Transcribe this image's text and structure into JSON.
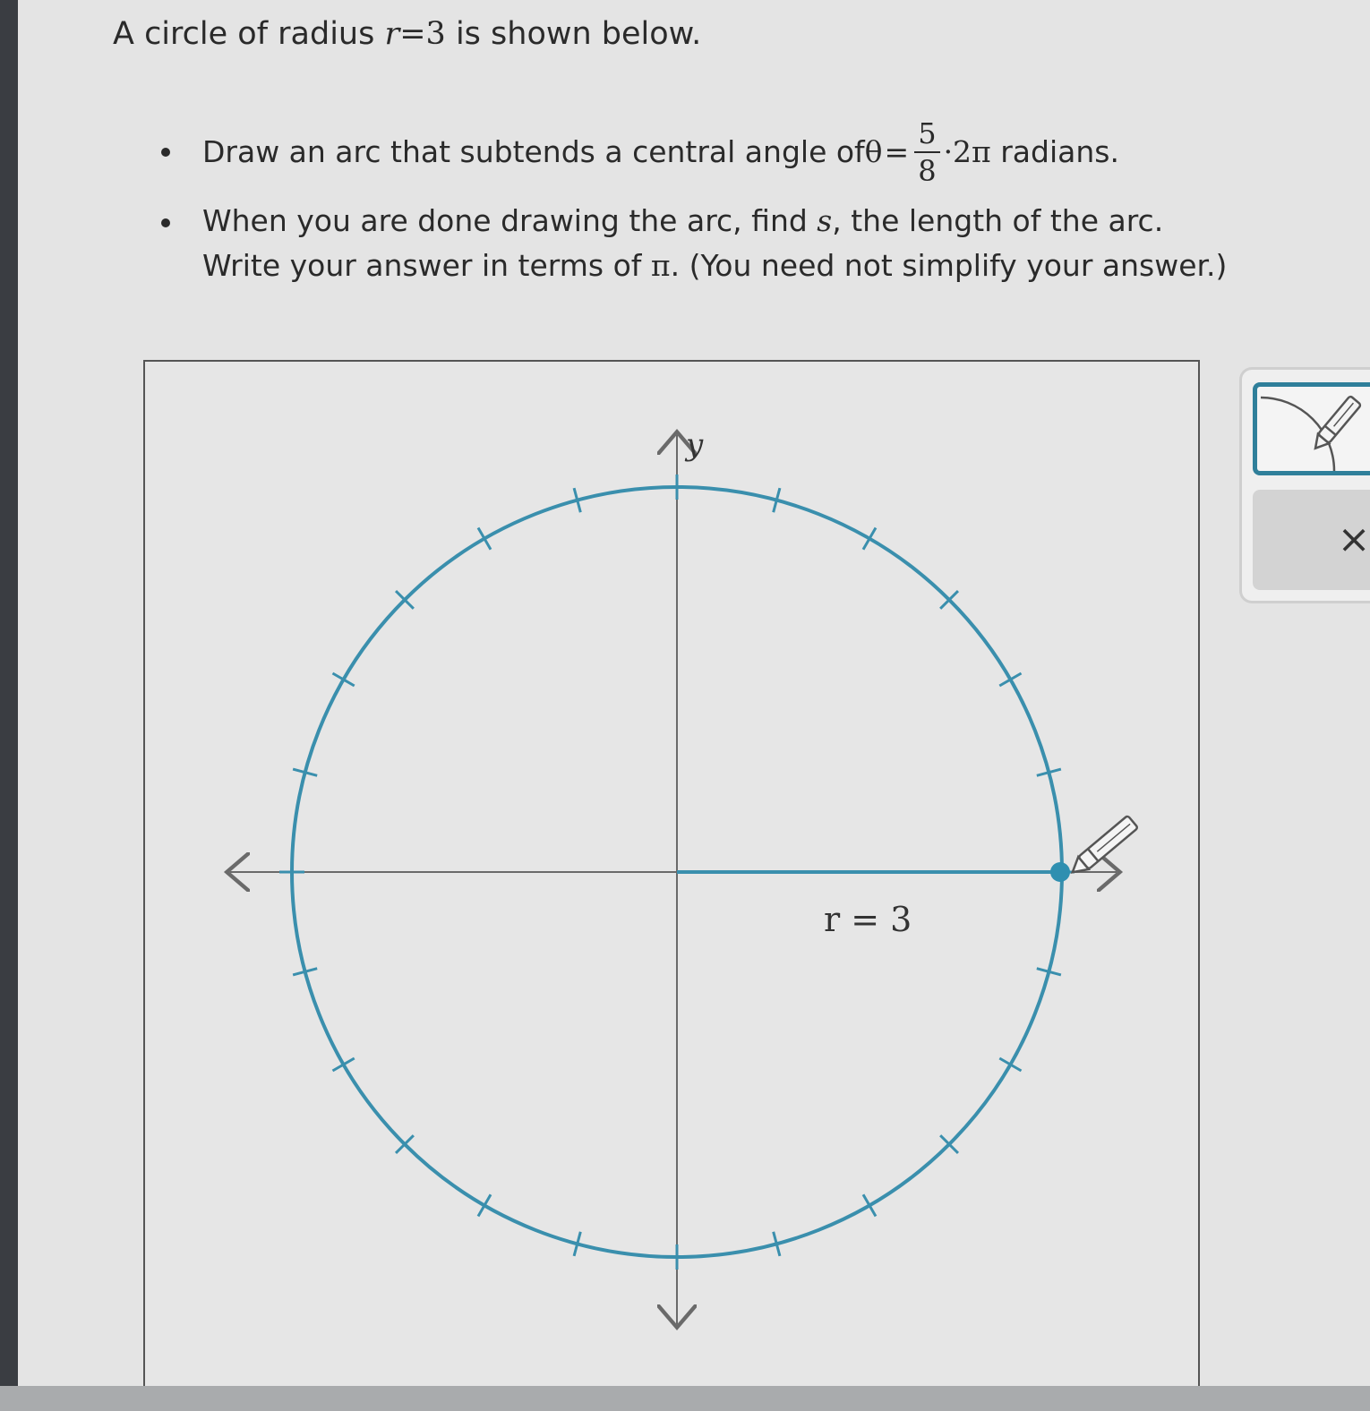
{
  "intro": {
    "prefix": "A circle of radius ",
    "var_r": "r",
    "eq": "=",
    "r_value": "3",
    "suffix": " is shown below."
  },
  "bullet1": {
    "text": "Draw an arc that subtends a central angle of ",
    "theta": "θ",
    "eq": "=",
    "frac_num": "5",
    "frac_den": "8",
    "times_2pi": "·2π",
    "suffix": " radians."
  },
  "bullet2": {
    "line1_a": "When you are done drawing the arc, find ",
    "var_s": "s",
    "line1_b": ", the length of the arc.",
    "line2_a": "Write your answer in terms of ",
    "pi": "π",
    "line2_b": ". (You need not simplify your answer.)"
  },
  "graph": {
    "y_axis_label": "y",
    "radius_label": "r = 3",
    "radius": 3,
    "tick_count": 24,
    "circle_color": "#3a8fad",
    "axis_color": "#6a6a6a"
  },
  "tools": {
    "draw_arc_icon": "arc-pencil-icon",
    "clear_icon": "close-icon",
    "clear_label": "×"
  }
}
